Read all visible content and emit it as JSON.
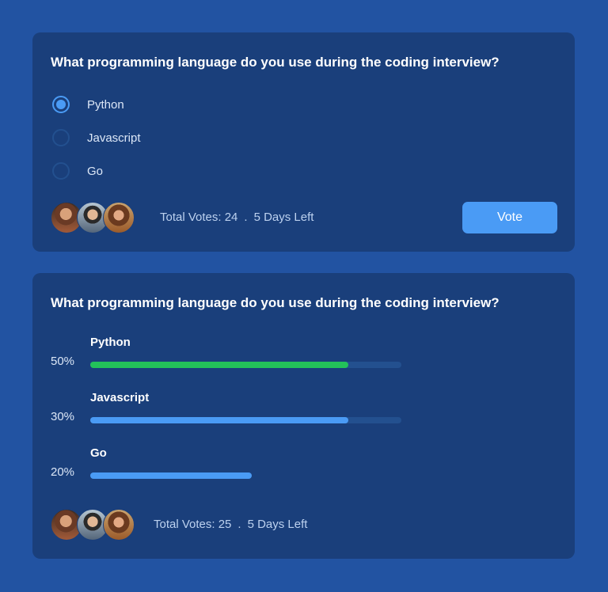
{
  "vote_card": {
    "question": "What programming language do you use during the coding interview?",
    "options": [
      {
        "label": "Python",
        "selected": true
      },
      {
        "label": "Javascript",
        "selected": false
      },
      {
        "label": "Go",
        "selected": false
      }
    ],
    "total_votes": "Total Votes: 24",
    "separator": ".",
    "days_left": "5 Days Left",
    "vote_label": "Vote"
  },
  "results_card": {
    "question": "What programming language do you use during the coding interview?",
    "results": [
      {
        "label": "Python",
        "percent_label": "50%",
        "bar_fraction": 0.83,
        "color": "#23c25a"
      },
      {
        "label": "Javascript",
        "percent_label": "30%",
        "bar_fraction": 0.83,
        "color": "#4a9bf5"
      },
      {
        "label": "Go",
        "percent_label": "20%",
        "bar_fraction": 0.52,
        "color": "#4a9bf5"
      }
    ],
    "total_votes": "Total Votes: 25",
    "separator": ".",
    "days_left": "5 Days Left"
  },
  "colors": {
    "background": "#2253a2",
    "card": "#1a3f7b",
    "accent": "#4a9bf5",
    "success": "#23c25a",
    "track": "#23508f"
  }
}
